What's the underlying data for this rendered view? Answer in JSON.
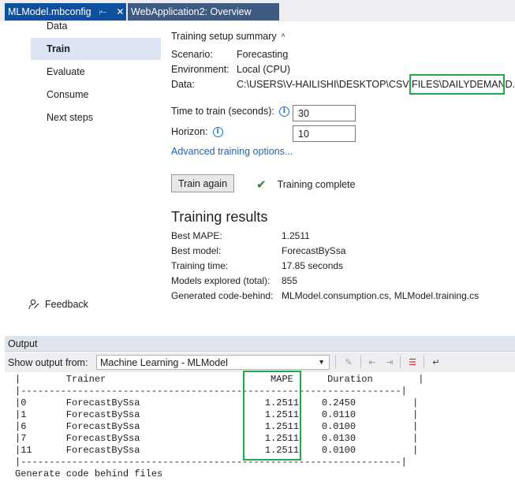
{
  "tabs": [
    {
      "label": "MLModel.mbconfig",
      "pin": "⥒",
      "close": "✕"
    },
    {
      "label": "WebApplication2: Overview"
    }
  ],
  "nav": {
    "items": [
      "Data",
      "Train",
      "Evaluate",
      "Consume",
      "Next steps"
    ],
    "selected": "Train",
    "feedback": "Feedback"
  },
  "summary": {
    "heading": "Training setup summary",
    "caret": "^",
    "scenario_label": "Scenario:",
    "scenario_value": "Forecasting",
    "environment_label": "Environment:",
    "environment_value": "Local (CPU)",
    "data_label": "Data:",
    "data_value": "C:\\USERS\\V-HAILISHI\\DESKTOP\\CSV FILES\\DAILYDEMAND.MDF"
  },
  "settings": {
    "time_label": "Time to train (seconds):",
    "time_value": "30",
    "horizon_label": "Horizon:",
    "horizon_value": "10",
    "info_icon": "i",
    "advanced_link": "Advanced training options..."
  },
  "actions": {
    "train_again": "Train again",
    "status": "Training complete",
    "check": "✔"
  },
  "results": {
    "heading": "Training results",
    "rows": [
      {
        "label": "Best MAPE:",
        "value": "1.2511"
      },
      {
        "label": "Best model:",
        "value": "ForecastBySsa"
      },
      {
        "label": "Training time:",
        "value": "17.85 seconds"
      },
      {
        "label": "Models explored (total):",
        "value": "855"
      },
      {
        "label": "Generated code-behind:",
        "value": "MLModel.consumption.cs, MLModel.training.cs"
      }
    ]
  },
  "output": {
    "title": "Output",
    "show_from_label": "Show output from:",
    "source": "Machine Learning - MLModel",
    "lines": [
      "|        Trainer                             MAPE      Duration        |",
      "|-------------------------------------------------------------------|",
      "|0       ForecastBySsa                      1.2511    0.2450          |",
      "|1       ForecastBySsa                      1.2511    0.0110          |",
      "|6       ForecastBySsa                      1.2511    0.0100          |",
      "|7       ForecastBySsa                      1.2511    0.0130          |",
      "|11      ForecastBySsa                      1.2511    0.0100          |",
      "|-------------------------------------------------------------------|",
      "Generate code behind files"
    ]
  },
  "colors": {
    "highlight": "#22a846",
    "tab_active": "#0e4f9e",
    "link": "#1e63b8",
    "nav_selected": "#dde5f4"
  }
}
